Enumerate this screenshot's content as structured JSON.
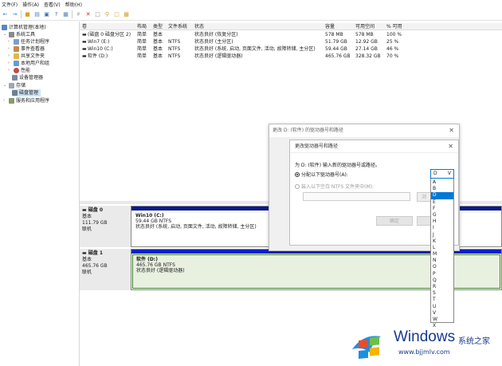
{
  "menu": [
    "文件(F)",
    "操作(A)",
    "查看(V)",
    "帮助(H)"
  ],
  "tree": {
    "root": "计算机管理(本地)",
    "system_tools": "系统工具",
    "task_scheduler": "任务计划程序",
    "event_viewer": "事件查看器",
    "shared_folders": "共享文件夹",
    "local_users": "本地用户和组",
    "performance": "性能",
    "device_manager": "设备管理器",
    "storage": "存储",
    "disk_management": "磁盘管理",
    "services": "服务和应用程序"
  },
  "volumes": {
    "headers": [
      "卷",
      "布局",
      "类型",
      "文件系统",
      "状态",
      "容量",
      "可用空间",
      "% 可用"
    ],
    "rows": [
      [
        "(磁盘 0 磁盘分区 2)",
        "简单",
        "基本",
        "",
        "状态良好 (恢复分区)",
        "578 MB",
        "578 MB",
        "100 %"
      ],
      [
        "Win7 (E:)",
        "简单",
        "基本",
        "NTFS",
        "状态良好 (主分区)",
        "51.79 GB",
        "12.92 GB",
        "25 %"
      ],
      [
        "Win10 (C:)",
        "简单",
        "基本",
        "NTFS",
        "状态良好 (系统, 启动, 页面文件, 活动, 故障转储, 主分区)",
        "59.44 GB",
        "27.14 GB",
        "46 %"
      ],
      [
        "软件 (D:)",
        "简单",
        "基本",
        "NTFS",
        "状态良好 (逻辑驱动器)",
        "465.76 GB",
        "328.32 GB",
        "70 %"
      ]
    ]
  },
  "disk0": {
    "name": "磁盘 0",
    "type": "基本",
    "size": "111.79 GB",
    "status": "联机",
    "partition": {
      "name": "Win10  (C:)",
      "size": "59.44 GB NTFS",
      "status": "状态良好 (系统, 启动, 页面文件, 活动, 故障转储, 主分区)"
    }
  },
  "disk1": {
    "name": "磁盘 1",
    "type": "基本",
    "size": "465.76 GB",
    "status": "联机",
    "partition": {
      "name": "软件  (D:)",
      "size": "465.76 GB NTFS",
      "status": "状态良好 (逻辑驱动器)"
    }
  },
  "outer_dialog": {
    "title": "更改 D: (软件) 的驱动器号和路径",
    "ok": "确定"
  },
  "inner_dialog": {
    "title": "更改驱动器号和路径",
    "prompt": "为 D: (软件) 输入新的驱动器号或路径。",
    "assign_letter": "分配以下驱动器号(A):",
    "mount_folder": "装入以下空白 NTFS 文件夹中(M):",
    "ok": "确定",
    "browse": "浏"
  },
  "drive_combo": {
    "selected": "D",
    "arrow": "V"
  },
  "drive_letters": [
    "A",
    "B",
    "D",
    "E",
    "F",
    "G",
    "H",
    "I",
    "J",
    "K",
    "L",
    "M",
    "N",
    "O",
    "P",
    "Q",
    "R",
    "S",
    "T",
    "U",
    "V",
    "W",
    "X"
  ],
  "watermark": {
    "brand": "Windows",
    "cn": "系统之家",
    "url": "www.bjjmlv.com"
  },
  "colors": {
    "partition_bar": "#0a1a8c",
    "disk1_bar": "#0022cc",
    "selection": "#0078d7",
    "watermark": "#173a8f"
  }
}
